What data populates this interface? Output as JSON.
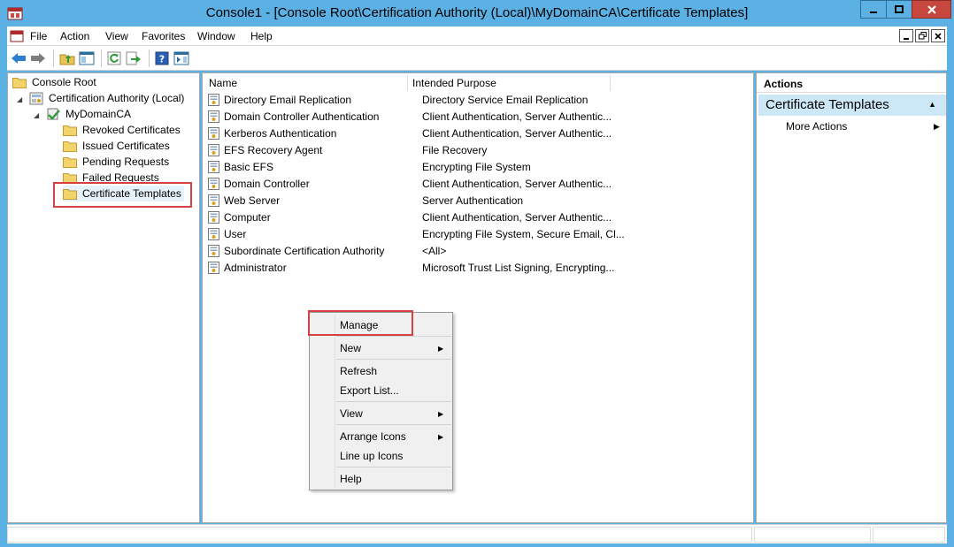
{
  "window": {
    "title": "Console1 - [Console Root\\Certification Authority (Local)\\MyDomainCA\\Certificate Templates]"
  },
  "menubar": {
    "items": [
      "File",
      "Action",
      "View",
      "Favorites",
      "Window",
      "Help"
    ]
  },
  "toolbar": {
    "buttons": [
      "back-arrow-icon",
      "forward-arrow-icon",
      "up-folder-icon",
      "show-tree-icon",
      "refresh-icon",
      "export-list-icon",
      "help-icon",
      "show-action-pane-icon"
    ]
  },
  "tree": {
    "root": "Console Root",
    "ca": "Certification Authority (Local)",
    "server": "MyDomainCA",
    "items": [
      "Revoked Certificates",
      "Issued Certificates",
      "Pending Requests",
      "Failed Requests",
      "Certificate Templates"
    ]
  },
  "list": {
    "columns": [
      "Name",
      "Intended Purpose"
    ],
    "rows": [
      {
        "name": "Directory Email Replication",
        "purpose": "Directory Service Email Replication"
      },
      {
        "name": "Domain Controller Authentication",
        "purpose": "Client Authentication, Server Authentic..."
      },
      {
        "name": "Kerberos Authentication",
        "purpose": "Client Authentication, Server Authentic..."
      },
      {
        "name": "EFS Recovery Agent",
        "purpose": "File Recovery"
      },
      {
        "name": "Basic EFS",
        "purpose": "Encrypting File System"
      },
      {
        "name": "Domain Controller",
        "purpose": "Client Authentication, Server Authentic..."
      },
      {
        "name": "Web Server",
        "purpose": "Server Authentication"
      },
      {
        "name": "Computer",
        "purpose": "Client Authentication, Server Authentic..."
      },
      {
        "name": "User",
        "purpose": "Encrypting File System, Secure Email, Cl..."
      },
      {
        "name": "Subordinate Certification Authority",
        "purpose": "<All>"
      },
      {
        "name": "Administrator",
        "purpose": "Microsoft Trust List Signing, Encrypting..."
      }
    ]
  },
  "actions": {
    "title": "Actions",
    "section": "Certificate Templates",
    "more": "More Actions"
  },
  "context_menu": {
    "manage": "Manage",
    "new": "New",
    "refresh": "Refresh",
    "export": "Export List...",
    "view": "View",
    "arrange": "Arrange Icons",
    "lineup": "Line up Icons",
    "help": "Help"
  },
  "colors": {
    "titlebar": "#5bb0e4",
    "highlight": "#d64242",
    "selection": "#cce8f6"
  }
}
